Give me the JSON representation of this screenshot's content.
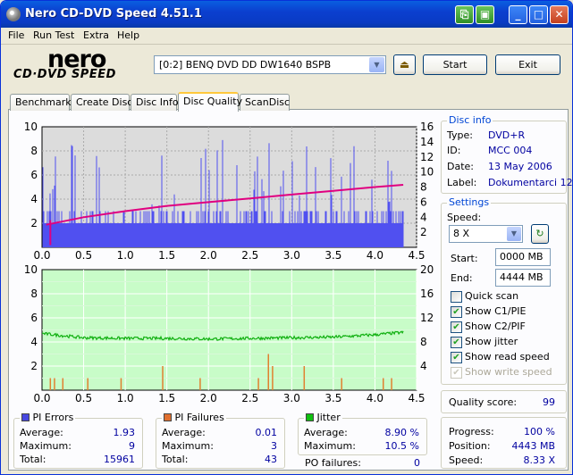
{
  "window": {
    "title": "Nero CD-DVD Speed 4.51.1"
  },
  "menu": [
    "File",
    "Run Test",
    "Extra",
    "Help"
  ],
  "logo": {
    "top": "nero",
    "bottom": "CD·DVD SPEED"
  },
  "drive": {
    "selected": "[0:2]   BENQ DVD DD DW1640 BSPB"
  },
  "buttons": {
    "start": "Start",
    "exit": "Exit"
  },
  "tabs": [
    "Benchmark",
    "Create Disc",
    "Disc Info",
    "Disc Quality",
    "ScanDisc"
  ],
  "disc_info": {
    "title": "Disc info",
    "type_label": "Type:",
    "type": "DVD+R",
    "id_label": "ID:",
    "id": "MCC 004",
    "date_label": "Date:",
    "date": "13 May 2006",
    "label_label": "Label:",
    "label": "Dokumentarci 12"
  },
  "settings": {
    "title": "Settings",
    "speed_label": "Speed:",
    "speed": "8 X",
    "start_label": "Start:",
    "start": "0000 MB",
    "end_label": "End:",
    "end": "4444 MB",
    "checkboxes": [
      {
        "label": "Quick scan",
        "checked": false,
        "disabled": false
      },
      {
        "label": "Show C1/PIE",
        "checked": true,
        "disabled": false
      },
      {
        "label": "Show C2/PIF",
        "checked": true,
        "disabled": false
      },
      {
        "label": "Show jitter",
        "checked": true,
        "disabled": false
      },
      {
        "label": "Show read speed",
        "checked": true,
        "disabled": false
      },
      {
        "label": "Show write speed",
        "checked": true,
        "disabled": true
      }
    ]
  },
  "quality": {
    "label": "Quality score:",
    "value": "99"
  },
  "progress": {
    "progress_label": "Progress:",
    "progress": "100 %",
    "position_label": "Position:",
    "position": "4443 MB",
    "speed_label": "Speed:",
    "speed": "8.33 X"
  },
  "pi_errors": {
    "title": "PI Errors",
    "avg_label": "Average:",
    "avg": "1.93",
    "max_label": "Maximum:",
    "max": "9",
    "total_label": "Total:",
    "total": "15961",
    "color": "#4848e0"
  },
  "pi_failures": {
    "title": "PI Failures",
    "avg_label": "Average:",
    "avg": "0.01",
    "max_label": "Maximum:",
    "max": "3",
    "total_label": "Total:",
    "total": "43",
    "color": "#e07030"
  },
  "jitter": {
    "title": "Jitter",
    "avg_label": "Average:",
    "avg": "8.90 %",
    "max_label": "Maximum:",
    "max": "10.5 %",
    "color": "#10c010"
  },
  "po_failures": {
    "label": "PO failures:",
    "value": "0"
  },
  "chart_data": [
    {
      "type": "bar",
      "name": "PI errors / read speed",
      "x_ticks": [
        "0.0",
        "0.5",
        "1.0",
        "1.5",
        "2.0",
        "2.5",
        "3.0",
        "3.5",
        "4.0",
        "4.5"
      ],
      "xlim": [
        0,
        4.5
      ],
      "y_left_ticks": [
        "2",
        "4",
        "6",
        "8",
        "10"
      ],
      "ylim_left": [
        0,
        10
      ],
      "y_right_ticks": [
        "2",
        "4",
        "6",
        "8",
        "10",
        "12",
        "14",
        "16"
      ],
      "ylim_right": [
        0,
        16
      ],
      "series": [
        {
          "name": "PI Errors",
          "color": "#5050f0",
          "typical": 2,
          "max": 9
        },
        {
          "name": "Read speed",
          "color": "#e00080",
          "x": [
            0.05,
            0.5,
            1.0,
            1.5,
            2.0,
            2.5,
            3.0,
            3.5,
            4.0,
            4.34
          ],
          "y": [
            3.0,
            4.0,
            4.8,
            5.5,
            6.0,
            6.5,
            7.0,
            7.5,
            8.0,
            8.3
          ]
        }
      ]
    },
    {
      "type": "bar",
      "name": "PI failures / jitter",
      "x_ticks": [
        "0.0",
        "0.5",
        "1.0",
        "1.5",
        "2.0",
        "2.5",
        "3.0",
        "3.5",
        "4.0",
        "4.5"
      ],
      "xlim": [
        0,
        4.5
      ],
      "y_left_ticks": [
        "2",
        "4",
        "6",
        "8",
        "10"
      ],
      "ylim_left": [
        0,
        10
      ],
      "y_right_ticks": [
        "4",
        "8",
        "12",
        "16",
        "20"
      ],
      "ylim_right": [
        0,
        20
      ],
      "series": [
        {
          "name": "PI Failures",
          "color": "#e08030",
          "x": [
            0.1,
            0.15,
            0.25,
            0.55,
            0.95,
            1.45,
            1.9,
            2.6,
            2.72,
            2.77,
            3.15,
            3.6,
            4.1,
            4.2
          ],
          "y": [
            1,
            1,
            1,
            1,
            1,
            2,
            1,
            1,
            3,
            2,
            2,
            1,
            1,
            1
          ]
        },
        {
          "name": "Jitter",
          "color": "#10b010",
          "x": [
            0.0,
            0.5,
            1.0,
            1.5,
            2.0,
            2.5,
            3.0,
            3.5,
            4.0,
            4.34
          ],
          "y": [
            9.4,
            8.7,
            8.6,
            8.6,
            8.5,
            8.6,
            8.7,
            8.8,
            9.2,
            9.6
          ]
        }
      ]
    }
  ]
}
